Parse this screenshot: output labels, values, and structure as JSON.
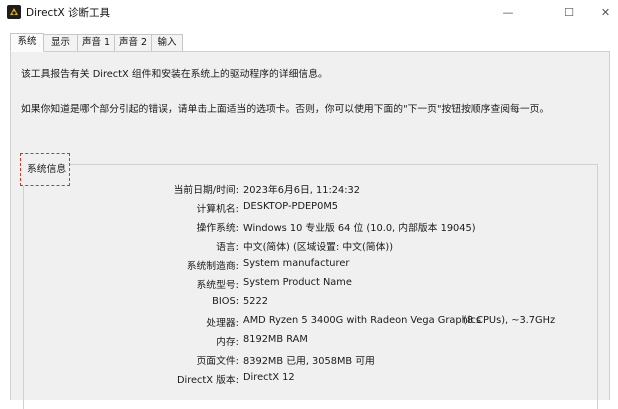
{
  "window": {
    "title": "DirectX 诊断工具",
    "minimize_glyph": "—",
    "maximize_glyph": "☐",
    "close_glyph": "✕"
  },
  "tabs": [
    {
      "label": "系统",
      "active": true
    },
    {
      "label": "显示",
      "active": false
    },
    {
      "label": "声音 1",
      "active": false
    },
    {
      "label": "声音 2",
      "active": false
    },
    {
      "label": "输入",
      "active": false
    }
  ],
  "intro": {
    "line1": "该工具报告有关 DirectX 组件和安装在系统上的驱动程序的详细信息。",
    "line2": "如果你知道是哪个部分引起的错误，请单击上面适当的选项卡。否则，你可以使用下面的\"下一页\"按钮按顺序查阅每一页。"
  },
  "system_info": {
    "group_label": "系统信息",
    "rows": [
      {
        "label": "当前日期/时间:",
        "value": "2023年6月6日, 11:24:32"
      },
      {
        "label": "计算机名:",
        "value": "DESKTOP-PDEP0M5"
      },
      {
        "label": "操作系统:",
        "value": "Windows 10 专业版 64 位 (10.0, 内部版本 19045)"
      },
      {
        "label": "语言:",
        "value": "中文(简体) (区域设置: 中文(简体))"
      },
      {
        "label": "系统制造商:",
        "value": "System manufacturer"
      },
      {
        "label": "系统型号:",
        "value": "System Product Name"
      },
      {
        "label": "BIOS:",
        "value": "5222"
      },
      {
        "label": "处理器:",
        "value": "AMD Ryzen 5 3400G with Radeon Vega Graphics",
        "extra": "(8 CPUs), ~3.7GHz"
      },
      {
        "label": "内存:",
        "value": "8192MB RAM"
      },
      {
        "label": "页面文件:",
        "value": "8392MB 已用, 3058MB 可用"
      },
      {
        "label": "DirectX 版本:",
        "value": "DirectX 12"
      }
    ]
  },
  "colors": {
    "accent_dash": "#e0301e",
    "panel_bg": "#f0f0f0"
  }
}
